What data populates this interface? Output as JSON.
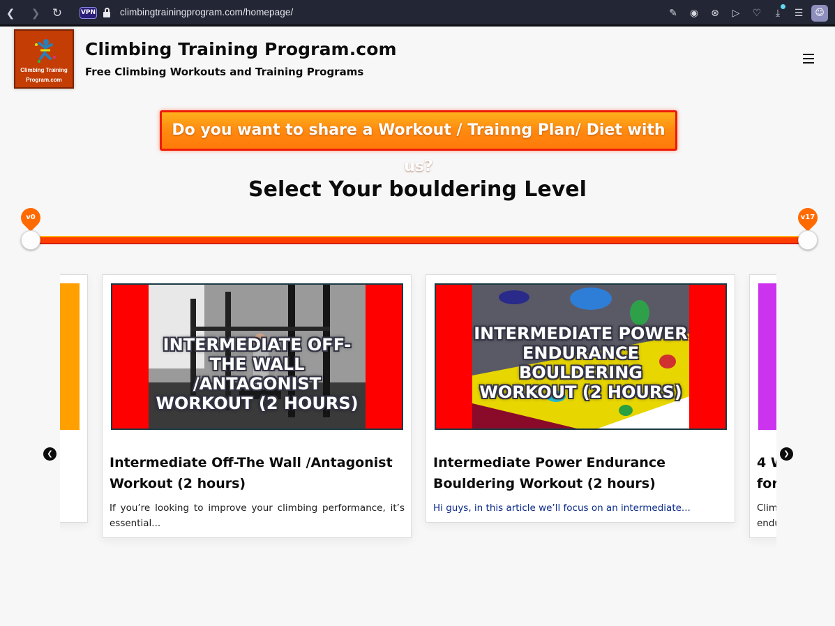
{
  "browser": {
    "vpn_label": "VPN",
    "url": "climbingtrainingprogram.com/homepage/"
  },
  "site": {
    "logo_line1": "Climbing Training",
    "logo_line2": "Program.com",
    "title": "Climbing Training Program.com",
    "tagline": "Free Climbing Workouts and Training Programs"
  },
  "cta": {
    "label": "Do you want to share a Workout / Trainng Plan/ Diet with us?"
  },
  "section": {
    "title": "Select Your bouldering Level"
  },
  "slider": {
    "min_label": "v0",
    "max_label": "v17",
    "accent": "#ff3d00"
  },
  "cards": [
    {
      "image_caption": "INTERMEDIATE OFF-THE WALL /ANTAGONIST WORKOUT (2 HOURS)",
      "title": "Intermediate Off-The Wall /Antagonist Workout (2 hours)",
      "excerpt": "If you’re looking to improve your climbing performance, it’s essential..."
    },
    {
      "image_caption": "INTERMEDIATE POWER ENDURANCE BOULDERING WORKOUT (2 HOURS)",
      "title": "Intermediate Power Endurance Bouldering Workout (2 hours)",
      "excerpt": "Hi guys, in this article we’ll focus on an intermediate..."
    },
    {
      "title_partial": "4 W",
      "title_partial2": "for",
      "excerpt_partial": "Clim",
      "excerpt_partial2": "endu"
    }
  ]
}
